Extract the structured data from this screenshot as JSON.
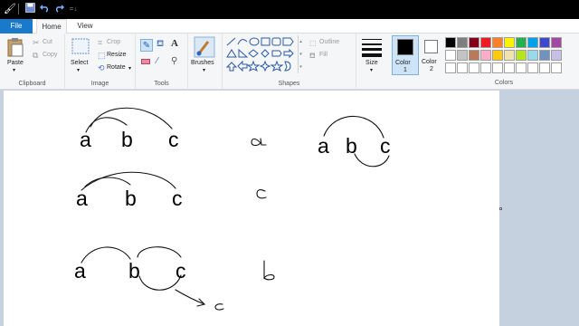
{
  "ribbon": {
    "tabs": {
      "file": "File",
      "home": "Home",
      "view": "View"
    },
    "clipboard": {
      "paste": "Paste",
      "cut": "Cut",
      "copy": "Copy",
      "group": "Clipboard"
    },
    "image": {
      "select": "Select",
      "crop": "Crop",
      "resize": "Resize",
      "rotate": "Rotate",
      "group": "Image"
    },
    "tools": {
      "group": "Tools"
    },
    "brushes": {
      "label": "Brushes"
    },
    "shapes": {
      "outline": "Outline",
      "fill": "Fill",
      "group": "Shapes"
    },
    "size": {
      "label": "Size"
    },
    "color1": {
      "label": "Color",
      "num": "1"
    },
    "color2": {
      "label": "Color",
      "num": "2"
    },
    "colors": {
      "group": "Colors"
    }
  },
  "palette": {
    "row1": [
      "#000000",
      "#7f7f7f",
      "#880015",
      "#ed1c24",
      "#ff7f27",
      "#fff200",
      "#22b14c",
      "#00a2e8",
      "#3f48cc",
      "#a349a4"
    ],
    "row2": [
      "#ffffff",
      "#c3c3c3",
      "#b97a57",
      "#ffaec9",
      "#ffc90e",
      "#efe4b0",
      "#b5e61d",
      "#99d9ea",
      "#7092be",
      "#c8bfe7"
    ],
    "row3": [
      "#ffffff",
      "#ffffff",
      "#ffffff",
      "#ffffff",
      "#ffffff",
      "#ffffff",
      "#ffffff",
      "#ffffff",
      "#ffffff",
      "#ffffff"
    ]
  },
  "canvas": {
    "letters": {
      "d1a": "a",
      "d1b": "b",
      "d1c": "c",
      "d2a": "a",
      "d2b": "b",
      "d2c": "c",
      "d3a": "a",
      "d3b": "b",
      "d3c": "c",
      "d4a": "a",
      "d4b": "b",
      "d4c": "c"
    }
  }
}
